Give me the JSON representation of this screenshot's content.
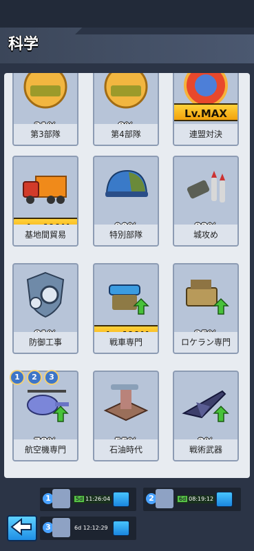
{
  "header": {
    "title": "科学"
  },
  "cards": [
    {
      "pct": "31%",
      "name": "第3部隊",
      "icon": "tank-icon"
    },
    {
      "pct": "8%",
      "name": "第4部隊",
      "icon": "tank-icon"
    },
    {
      "pct": "",
      "name": "連盟対決",
      "icon": "shield-emblem-icon",
      "max": "Lv.MAX"
    },
    {
      "pct": "",
      "name": "基地間貿易",
      "icon": "truck-icon",
      "max": "Lv.MAX"
    },
    {
      "pct": "90%",
      "name": "特別部隊",
      "icon": "helmet-icon"
    },
    {
      "pct": "82%",
      "name": "城攻め",
      "icon": "missile-icon"
    },
    {
      "pct": "81%",
      "name": "防御工事",
      "icon": "gear-shield-icon"
    },
    {
      "pct": "",
      "name": "戦車専門",
      "icon": "cannon-icon",
      "max": "Lv.MAX"
    },
    {
      "pct": "25%",
      "name": "ロケラン専門",
      "icon": "rocket-launcher-icon"
    },
    {
      "pct": "78%",
      "name": "航空機専門",
      "icon": "helicopter-icon"
    },
    {
      "pct": "55%",
      "name": "石油時代",
      "icon": "oil-pump-icon"
    },
    {
      "pct": "2%",
      "name": "戦術武器",
      "icon": "jet-icon"
    }
  ],
  "level_badges": [
    "1",
    "2",
    "3"
  ],
  "queues": [
    {
      "num": "1",
      "days": "5d",
      "time": "11:26:04"
    },
    {
      "num": "2",
      "days": "6d",
      "time": "08:19:12"
    },
    {
      "num": "3",
      "days": "6d",
      "time": "12:12:29"
    }
  ]
}
